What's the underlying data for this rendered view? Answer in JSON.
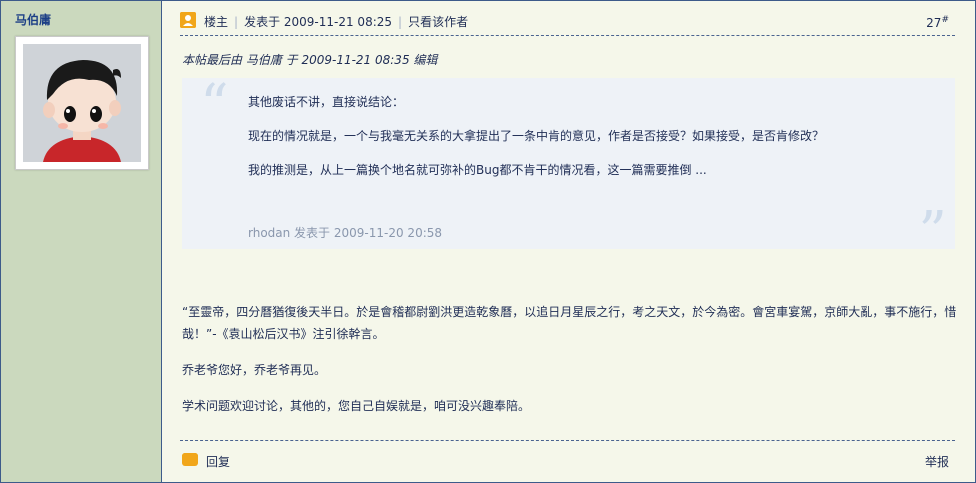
{
  "author": {
    "name": "马伯庸"
  },
  "post": {
    "badge": "楼主",
    "posted_at": "发表于 2009-11-21 08:25",
    "only_author": "只看该作者",
    "floor_number": "27",
    "floor_mark": "#",
    "edit_note": "本帖最后由 马伯庸 于 2009-11-21 08:35 编辑"
  },
  "quote": {
    "open_mark": "“",
    "close_mark": "”",
    "paragraphs": [
      "其他废话不讲，直接说结论：",
      "现在的情况就是，一个与我毫无关系的大拿提出了一条中肯的意见，作者是否接受？如果接受，是否肯修改？",
      "我的推测是，从上一篇换个地名就可弥补的Bug都不肯干的情况看，这一篇需要推倒 ..."
    ],
    "source": "rhodan 发表于 2009-11-20 20:58"
  },
  "body": {
    "paragraphs": [
      "“至靈帝，四分曆猶復後天半日。於是會稽都尉劉洪更造乾象曆，以追日月星辰之行，考之天文，於今為密。會宮車宴駕，京師大亂，事不施行，惜哉！”-《袁山松后汉书》注引徐幹言。",
      "乔老爷您好，乔老爷再见。",
      "学术问题欢迎讨论，其他的，您自己自娱就是，咱可没兴趣奉陪。"
    ]
  },
  "footer": {
    "reply_label": "回复",
    "report_label": "举报"
  },
  "colors": {
    "sidebar_bg": "#cbd9be",
    "content_bg": "#f5f7ea",
    "accent": "#f1a61a",
    "text": "#1f2d55"
  }
}
